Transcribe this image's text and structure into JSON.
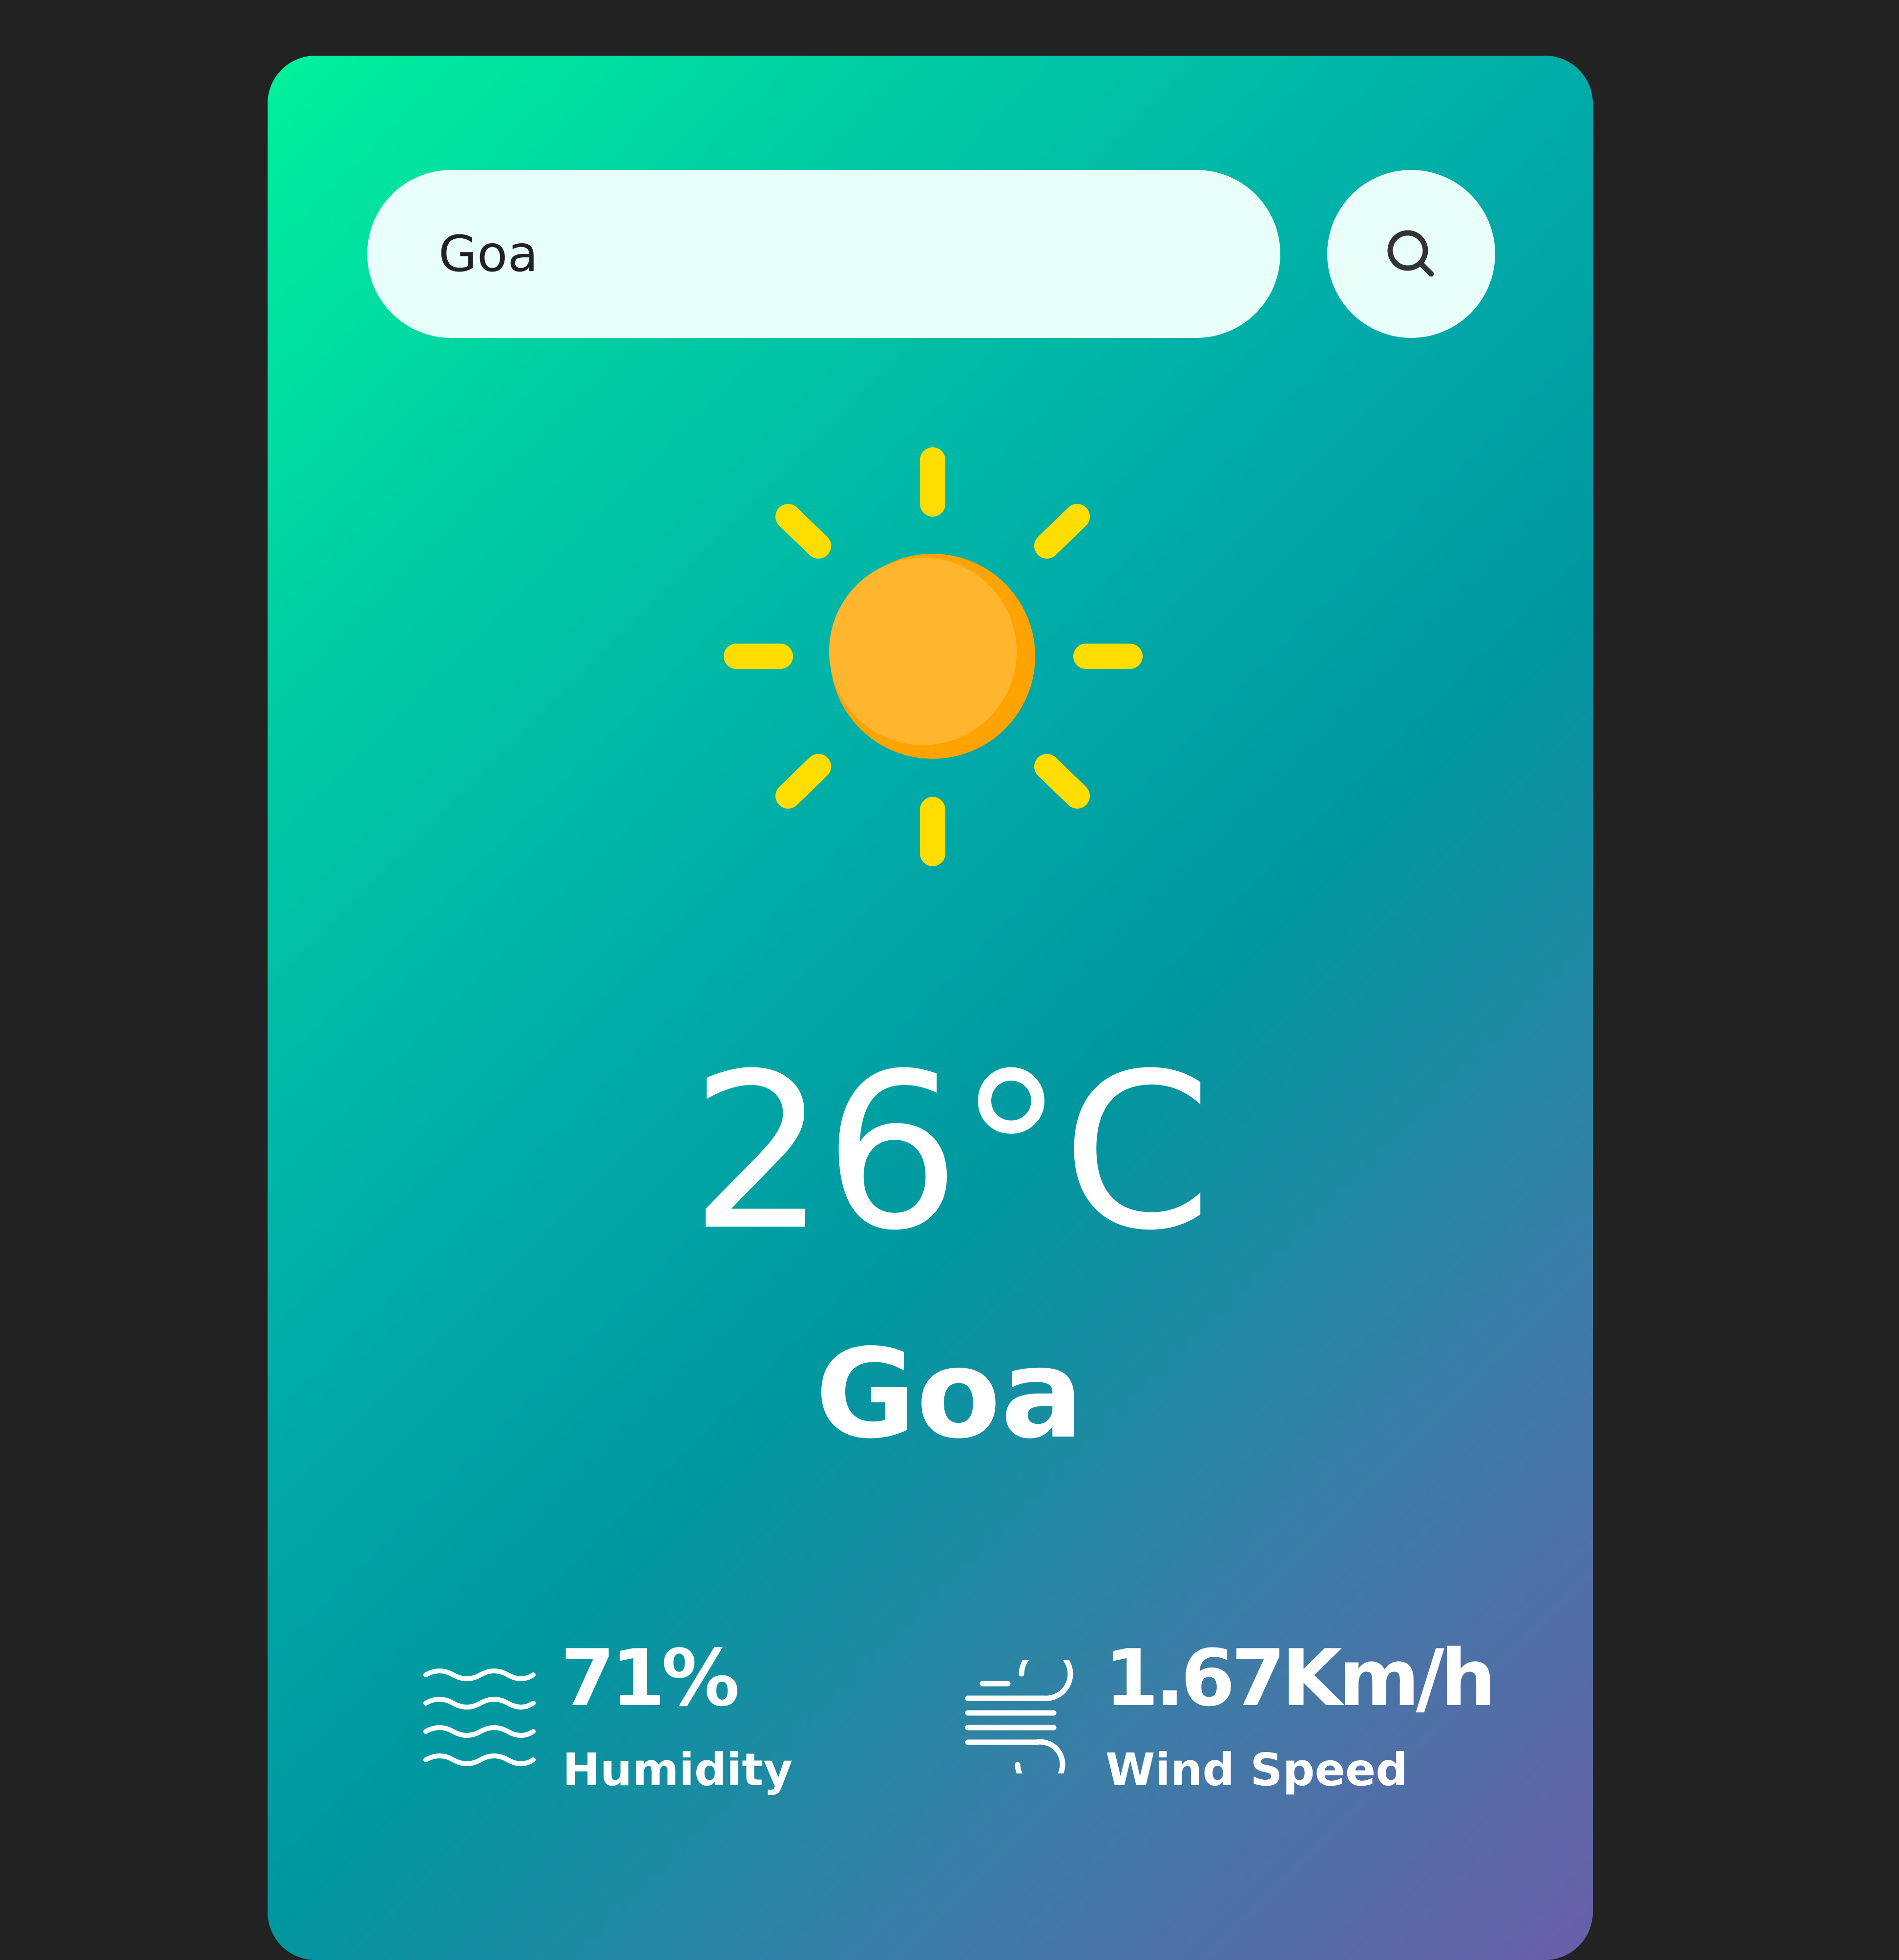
{
  "search": {
    "value": "Goa",
    "icon": "search-icon"
  },
  "weather": {
    "icon": "sun-icon",
    "temperature": "26°C",
    "city": "Goa"
  },
  "details": {
    "humidity": {
      "icon": "humidity-icon",
      "value": "71%",
      "label": "Humidity"
    },
    "wind": {
      "icon": "wind-icon",
      "value": "1.67Km/h",
      "label": "Wind Speed"
    }
  },
  "colors": {
    "background": "#222222",
    "card_gradient_start": "#00f29c",
    "card_gradient_mid": "#00979f",
    "card_gradient_end": "#6a5ea8",
    "input_background": "#e9fff9",
    "sun_core": "#ffb52e",
    "sun_rays": "#ffdd00"
  }
}
